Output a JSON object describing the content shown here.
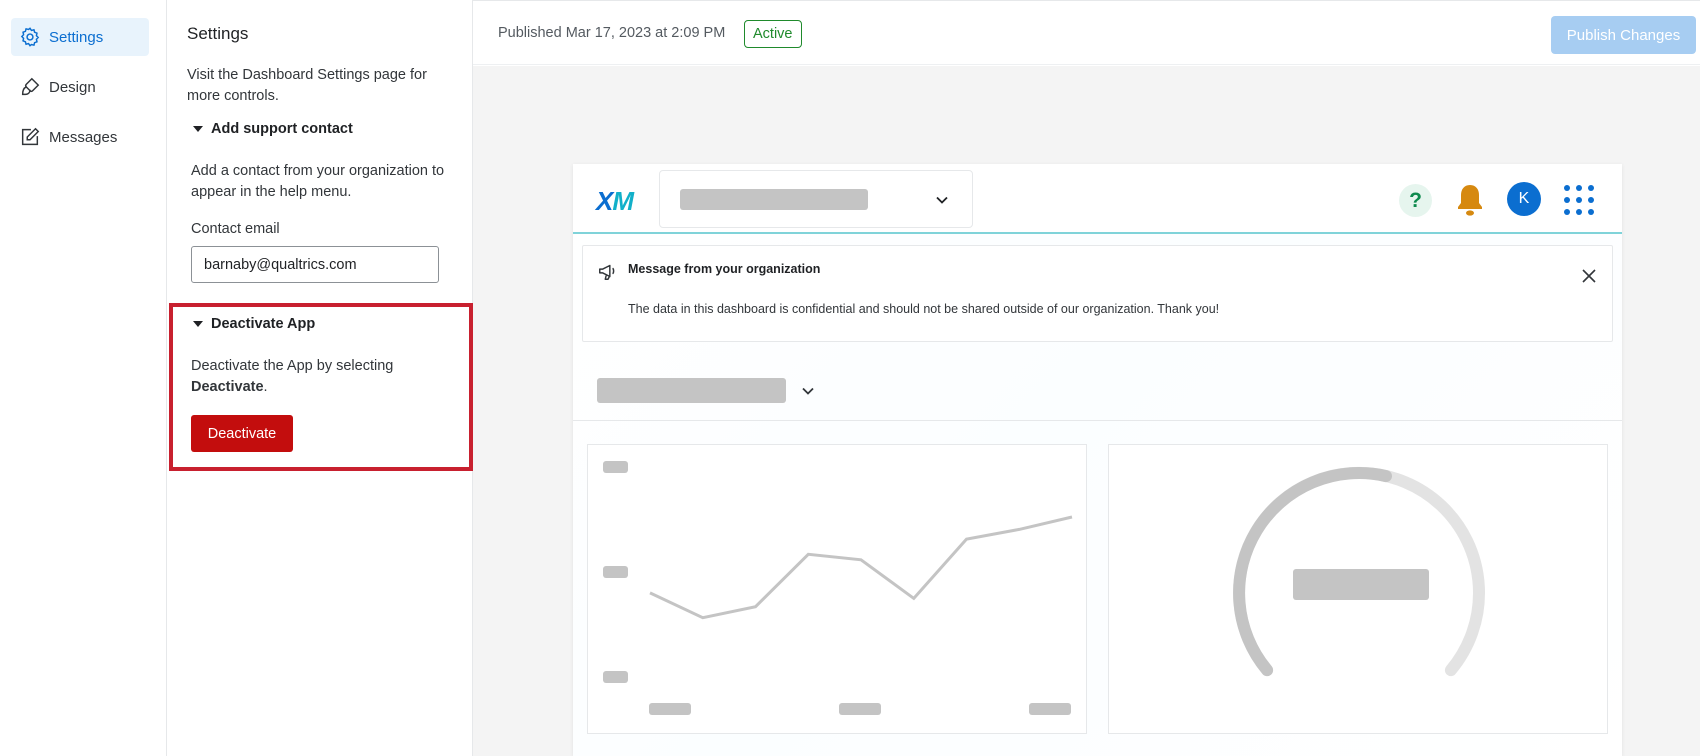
{
  "nav": {
    "items": [
      {
        "label": "Settings",
        "icon": "gear-icon",
        "active": true
      },
      {
        "label": "Design",
        "icon": "brush-icon",
        "active": false
      },
      {
        "label": "Messages",
        "icon": "edit-icon",
        "active": false
      }
    ]
  },
  "panel": {
    "title": "Settings",
    "description": "Visit the Dashboard Settings page for more controls.",
    "support": {
      "heading": "Add support contact",
      "text": "Add a contact from your organization to appear in the help menu.",
      "email_label": "Contact email",
      "email_value": "barnaby@qualtrics.com"
    },
    "deactivate": {
      "heading": "Deactivate App",
      "text_prefix": "Deactivate the App by selecting ",
      "text_bold": "Deactivate",
      "text_suffix": ".",
      "button_label": "Deactivate"
    }
  },
  "topbar": {
    "published": "Published Mar 17, 2023 at 2:09 PM",
    "status": "Active",
    "publish_button": "Publish Changes"
  },
  "preview": {
    "logo_x": "X",
    "logo_m": "M",
    "avatar_initial": "K",
    "help_glyph": "?",
    "message": {
      "title": "Message from your organization",
      "body": "The data in this dashboard is confidential and should not be shared outside of our organization. Thank you!"
    },
    "line_widget": {
      "points": [
        0.45,
        0.27,
        0.35,
        0.73,
        0.69,
        0.41,
        0.84,
        0.91,
        1.0
      ]
    },
    "gauge_widget": {
      "fill_fraction": 0.55
    }
  },
  "colors": {
    "accent": "#0b6ed0",
    "danger": "#c30d0d",
    "highlight": "#c8202f",
    "active_green": "#1f8a2c",
    "publish_disabled": "#a7cdf2"
  }
}
